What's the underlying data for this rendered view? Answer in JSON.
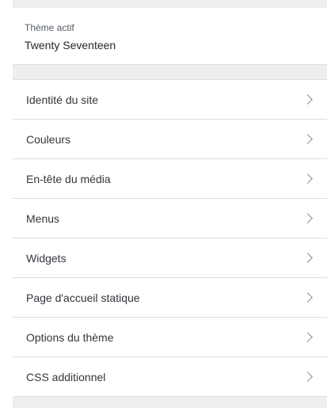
{
  "theme": {
    "label": "Thème actif",
    "name": "Twenty Seventeen"
  },
  "menu": {
    "items": [
      {
        "label": "Identité du site",
        "icon": "chevron-right-icon"
      },
      {
        "label": "Couleurs",
        "icon": "chevron-right-icon"
      },
      {
        "label": "En-tête du média",
        "icon": "chevron-right-icon"
      },
      {
        "label": "Menus",
        "icon": "chevron-right-icon"
      },
      {
        "label": "Widgets",
        "icon": "chevron-right-icon"
      },
      {
        "label": "Page d'accueil statique",
        "icon": "chevron-right-icon"
      },
      {
        "label": "Options du thème",
        "icon": "chevron-right-icon"
      },
      {
        "label": "CSS additionnel",
        "icon": "chevron-right-icon"
      }
    ]
  },
  "colors": {
    "panel_background": "#eeeeee",
    "item_background": "#ffffff",
    "divider": "#dddddd",
    "text": "#32373c",
    "muted_text": "#555d66",
    "chevron": "#8c8f94"
  }
}
